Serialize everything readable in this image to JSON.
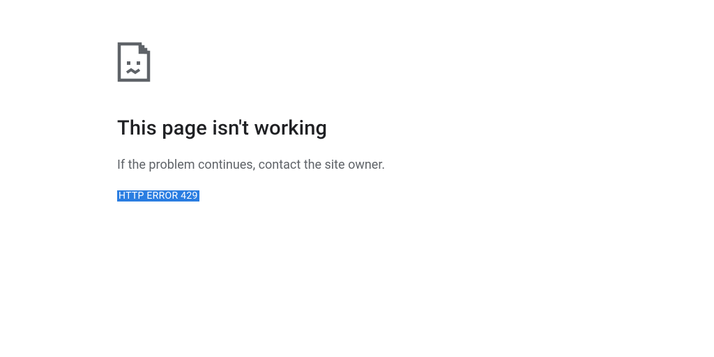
{
  "error": {
    "title": "This page isn't working",
    "message": "If the problem continues, contact the site owner.",
    "code": "HTTP ERROR 429"
  },
  "colors": {
    "highlight": "#2a7de1",
    "text_primary": "#202124",
    "text_secondary": "#5f6368"
  },
  "icons": {
    "broken_file": "broken-file-icon"
  }
}
